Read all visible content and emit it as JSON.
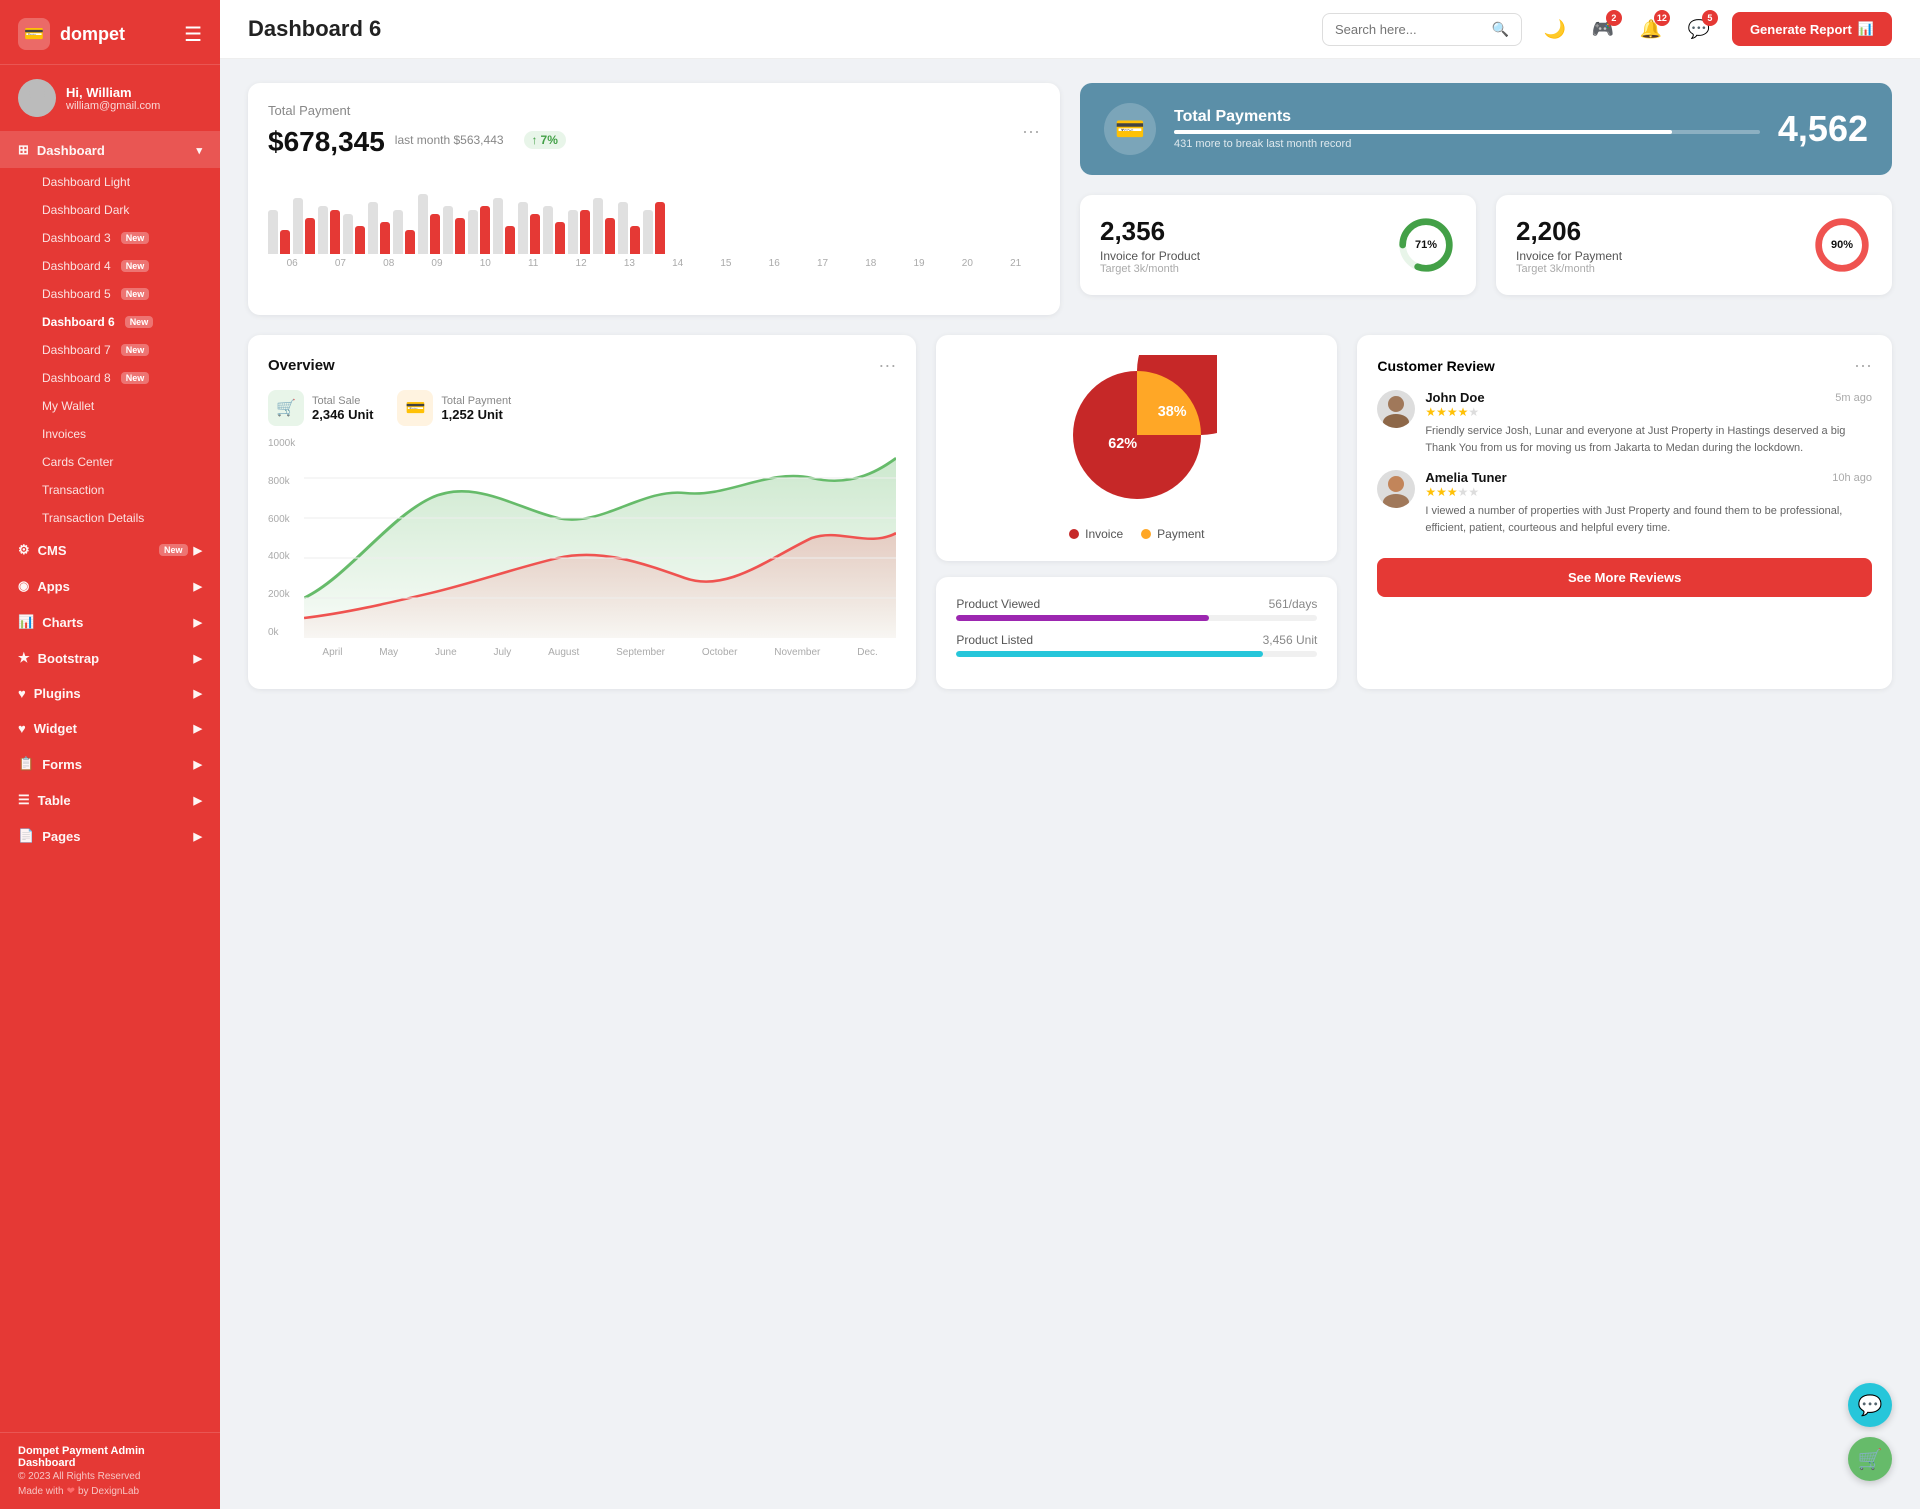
{
  "sidebar": {
    "logo": "dompet",
    "logo_icon": "💳",
    "hamburger": "☰",
    "profile": {
      "name": "Hi, William",
      "email": "william@gmail.com",
      "avatar": "👤"
    },
    "nav": [
      {
        "id": "dashboard",
        "label": "Dashboard",
        "icon": "⊞",
        "active": true,
        "arrow": "▾",
        "sub": [
          {
            "label": "Dashboard Light",
            "badge": ""
          },
          {
            "label": "Dashboard Dark",
            "badge": ""
          },
          {
            "label": "Dashboard 3",
            "badge": "New"
          },
          {
            "label": "Dashboard 4",
            "badge": "New"
          },
          {
            "label": "Dashboard 5",
            "badge": "New"
          },
          {
            "label": "Dashboard 6",
            "badge": "New",
            "active": true
          },
          {
            "label": "Dashboard 7",
            "badge": "New"
          },
          {
            "label": "Dashboard 8",
            "badge": "New"
          },
          {
            "label": "My Wallet",
            "badge": ""
          },
          {
            "label": "Invoices",
            "badge": ""
          },
          {
            "label": "Cards Center",
            "badge": ""
          },
          {
            "label": "Transaction",
            "badge": ""
          },
          {
            "label": "Transaction Details",
            "badge": ""
          }
        ]
      },
      {
        "id": "cms",
        "label": "CMS",
        "icon": "⚙",
        "badge": "New",
        "arrow": "▶"
      },
      {
        "id": "apps",
        "label": "Apps",
        "icon": "◉",
        "arrow": "▶"
      },
      {
        "id": "charts",
        "label": "Charts",
        "icon": "📊",
        "arrow": "▶"
      },
      {
        "id": "bootstrap",
        "label": "Bootstrap",
        "icon": "★",
        "arrow": "▶"
      },
      {
        "id": "plugins",
        "label": "Plugins",
        "icon": "♥",
        "arrow": "▶"
      },
      {
        "id": "widget",
        "label": "Widget",
        "icon": "♥",
        "arrow": "▶"
      },
      {
        "id": "forms",
        "label": "Forms",
        "icon": "🖨",
        "arrow": "▶"
      },
      {
        "id": "table",
        "label": "Table",
        "icon": "☰",
        "arrow": "▶"
      },
      {
        "id": "pages",
        "label": "Pages",
        "icon": "📋",
        "arrow": "▶"
      }
    ],
    "footer": {
      "brand": "Dompet Payment Admin Dashboard",
      "copy": "© 2023 All Rights Reserved",
      "made": "Made with ❤ by DexignLab"
    }
  },
  "header": {
    "title": "Dashboard 6",
    "search_placeholder": "Search here...",
    "icons": [
      {
        "name": "moon-icon",
        "symbol": "🌙",
        "badge": ""
      },
      {
        "name": "gamepad-icon",
        "symbol": "🎮",
        "badge": "2"
      },
      {
        "name": "bell-icon",
        "symbol": "🔔",
        "badge": "12"
      },
      {
        "name": "chat-icon",
        "symbol": "💬",
        "badge": "5"
      }
    ],
    "btn_generate": "Generate Report"
  },
  "total_payment": {
    "title": "Total Payment",
    "amount": "$678,345",
    "last_month_label": "last month $563,443",
    "trend": "7%",
    "bars": [
      {
        "light": 55,
        "dark": 30
      },
      {
        "light": 70,
        "dark": 45
      },
      {
        "light": 60,
        "dark": 55
      },
      {
        "light": 50,
        "dark": 35
      },
      {
        "light": 65,
        "dark": 40
      },
      {
        "light": 55,
        "dark": 30
      },
      {
        "light": 75,
        "dark": 50
      },
      {
        "light": 60,
        "dark": 45
      },
      {
        "light": 55,
        "dark": 60
      },
      {
        "light": 70,
        "dark": 35
      },
      {
        "light": 65,
        "dark": 50
      },
      {
        "light": 60,
        "dark": 40
      },
      {
        "light": 55,
        "dark": 55
      },
      {
        "light": 70,
        "dark": 45
      },
      {
        "light": 65,
        "dark": 35
      },
      {
        "light": 55,
        "dark": 65
      }
    ],
    "bar_labels": [
      "06",
      "07",
      "08",
      "09",
      "10",
      "11",
      "12",
      "13",
      "14",
      "15",
      "16",
      "17",
      "18",
      "19",
      "20",
      "21"
    ]
  },
  "total_payments_blue": {
    "title": "Total Payments",
    "sub": "431 more to break last month record",
    "number": "4,562",
    "bar_fill": "85"
  },
  "invoice_product": {
    "number": "2,356",
    "label": "Invoice for Product",
    "target": "Target 3k/month",
    "percent": 71,
    "color": "#43a047"
  },
  "invoice_payment": {
    "number": "2,206",
    "label": "Invoice for Payment",
    "target": "Target 3k/month",
    "percent": 90,
    "color": "#ef5350"
  },
  "overview": {
    "title": "Overview",
    "total_sale_label": "Total Sale",
    "total_sale_value": "2,346 Unit",
    "total_payment_label": "Total Payment",
    "total_payment_value": "1,252 Unit",
    "y_labels": [
      "1000k",
      "800k",
      "600k",
      "400k",
      "200k",
      "0k"
    ],
    "x_labels": [
      "April",
      "May",
      "June",
      "July",
      "August",
      "September",
      "October",
      "November",
      "Dec."
    ]
  },
  "pie_chart": {
    "invoice_pct": 62,
    "payment_pct": 38,
    "invoice_label": "Invoice",
    "payment_label": "Payment",
    "invoice_color": "#c62828",
    "payment_color": "#ffa726"
  },
  "product_stats": {
    "viewed_label": "Product Viewed",
    "viewed_value": "561/days",
    "viewed_color": "#9c27b0",
    "viewed_pct": 70,
    "listed_label": "Product Listed",
    "listed_value": "3,456 Unit",
    "listed_color": "#26c6da",
    "listed_pct": 85
  },
  "customer_review": {
    "title": "Customer Review",
    "reviews": [
      {
        "name": "John Doe",
        "time": "5m ago",
        "stars": 4,
        "text": "Friendly service Josh, Lunar and everyone at Just Property in Hastings deserved a big Thank You from us for moving us from Jakarta to Medan during the lockdown.",
        "avatar": "👨"
      },
      {
        "name": "Amelia Tuner",
        "time": "10h ago",
        "stars": 3,
        "text": "I viewed a number of properties with Just Property and found them to be professional, efficient, patient, courteous and helpful every time.",
        "avatar": "👩"
      }
    ],
    "btn_label": "See More Reviews"
  },
  "fabs": [
    {
      "icon": "💬",
      "color": "teal"
    },
    {
      "icon": "🛒",
      "color": "green"
    }
  ]
}
